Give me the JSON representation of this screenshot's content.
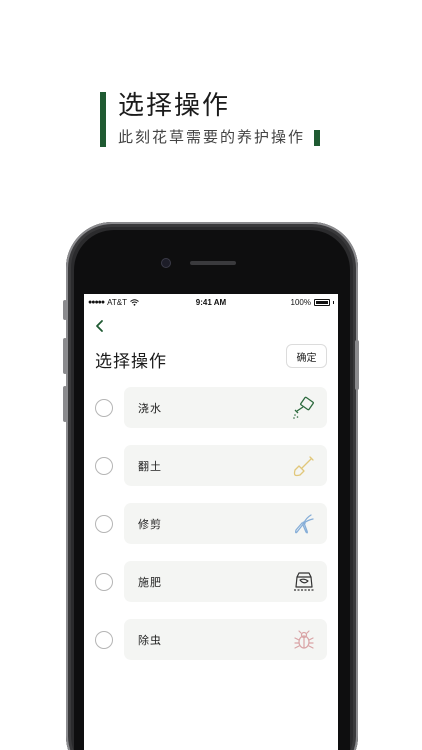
{
  "promo": {
    "title": "选择操作",
    "subtitle": "此刻花草需要的养护操作"
  },
  "status_bar": {
    "carrier": "AT&T",
    "time": "9:41 AM",
    "battery": "100%"
  },
  "header": {
    "title": "选择操作",
    "confirm_label": "确定"
  },
  "operations": [
    {
      "label": "浇水",
      "icon": "watering-can-icon",
      "color": "#2d6a3e"
    },
    {
      "label": "翻土",
      "icon": "shovel-icon",
      "color": "#e1c77a"
    },
    {
      "label": "修剪",
      "icon": "pruning-shears-icon",
      "color": "#86aed8"
    },
    {
      "label": "施肥",
      "icon": "fertilizer-icon",
      "color": "#333333"
    },
    {
      "label": "除虫",
      "icon": "bug-icon",
      "color": "#d9a4a6"
    }
  ],
  "colors": {
    "accent": "#1f5a32",
    "card_bg": "#f4f5f3"
  }
}
